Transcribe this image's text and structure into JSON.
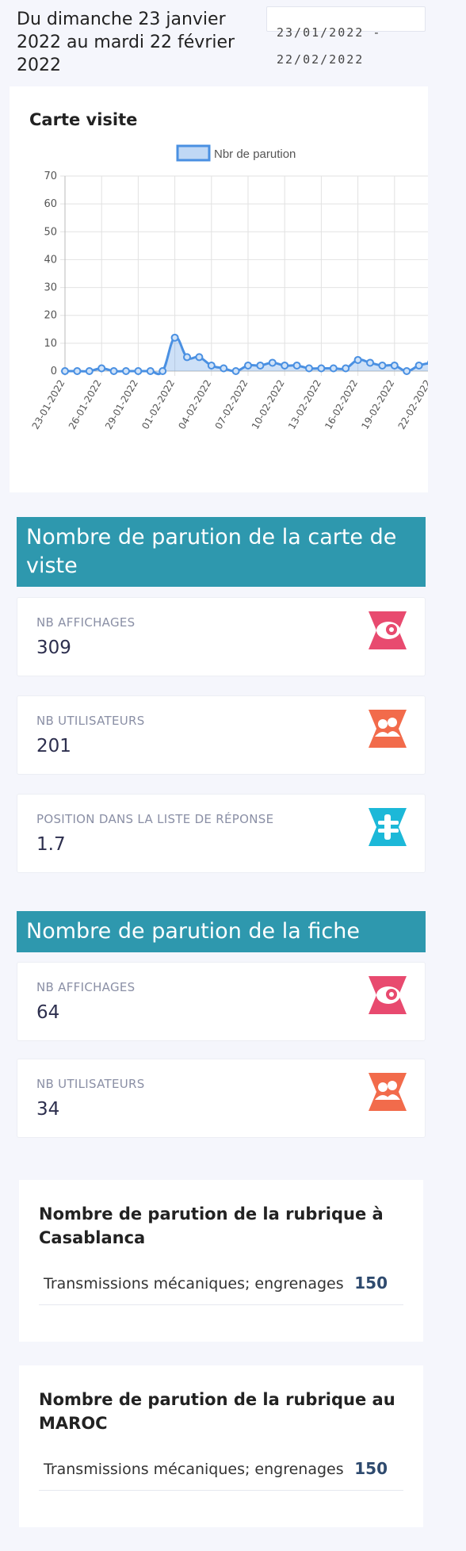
{
  "header": {
    "date_range_text": "Du dimanche 23 janvier 2022 au mardi 22 février 2022",
    "date_input_value": "23/01/2022 - 22/02/2022"
  },
  "chart_card": {
    "title": "Carte visite"
  },
  "chart_data": {
    "type": "line",
    "title": "Carte visite",
    "legend": [
      "Nbr de parution"
    ],
    "legend_position": "top",
    "series": [
      {
        "name": "Nbr de parution",
        "color": "#4a90e2",
        "values": [
          0,
          0,
          0,
          1,
          0,
          0,
          0,
          0,
          0,
          12,
          5,
          5,
          2,
          1,
          0,
          2,
          2,
          3,
          2,
          2,
          1,
          1,
          1,
          1,
          4,
          3,
          2,
          2,
          0,
          2,
          3
        ]
      }
    ],
    "x": [
      "23-01-2022",
      "24-01-2022",
      "25-01-2022",
      "26-01-2022",
      "27-01-2022",
      "28-01-2022",
      "29-01-2022",
      "30-01-2022",
      "31-01-2022",
      "01-02-2022",
      "02-02-2022",
      "03-02-2022",
      "04-02-2022",
      "05-02-2022",
      "06-02-2022",
      "07-02-2022",
      "08-02-2022",
      "09-02-2022",
      "10-02-2022",
      "11-02-2022",
      "12-02-2022",
      "13-02-2022",
      "14-02-2022",
      "15-02-2022",
      "16-02-2022",
      "17-02-2022",
      "18-02-2022",
      "19-02-2022",
      "20-02-2022",
      "21-02-2022",
      "22-02-2022"
    ],
    "xticks": [
      "23-01-2022",
      "26-01-2022",
      "29-01-2022",
      "01-02-2022",
      "04-02-2022",
      "07-02-2022",
      "10-02-2022",
      "13-02-2022",
      "16-02-2022",
      "19-02-2022",
      "22-02-2022"
    ],
    "yticks": [
      0,
      10,
      20,
      30,
      40,
      50,
      60,
      70
    ],
    "ylim": [
      0,
      70
    ],
    "grid": true
  },
  "section1": {
    "title": "Nombre de parution de la carte de viste",
    "stats": [
      {
        "label": "NB AFFICHAGES",
        "value": "309",
        "icon": "eye-icon",
        "color": "#e84a6f"
      },
      {
        "label": "NB UTILISATEURS",
        "value": "201",
        "icon": "users-icon",
        "color": "#f26b4b"
      },
      {
        "label": "POSITION DANS LA LISTE DE RÉPONSE",
        "value": "1.7",
        "icon": "list-icon",
        "color": "#1cb8d8"
      }
    ]
  },
  "section2": {
    "title": "Nombre de parution de la fiche",
    "stats": [
      {
        "label": "NB AFFICHAGES",
        "value": "64",
        "icon": "eye-icon",
        "color": "#e84a6f"
      },
      {
        "label": "NB UTILISATEURS",
        "value": "34",
        "icon": "users-icon",
        "color": "#f26b4b"
      }
    ]
  },
  "rubrique_casablanca": {
    "title": "Nombre de parution de la rubrique à Casablanca",
    "row_label": "Transmissions mécaniques; engrenages",
    "row_count": "150"
  },
  "rubrique_maroc": {
    "title": "Nombre de parution de la rubrique au MAROC",
    "row_label": "Transmissions mécaniques; engrenages",
    "row_count": "150"
  }
}
